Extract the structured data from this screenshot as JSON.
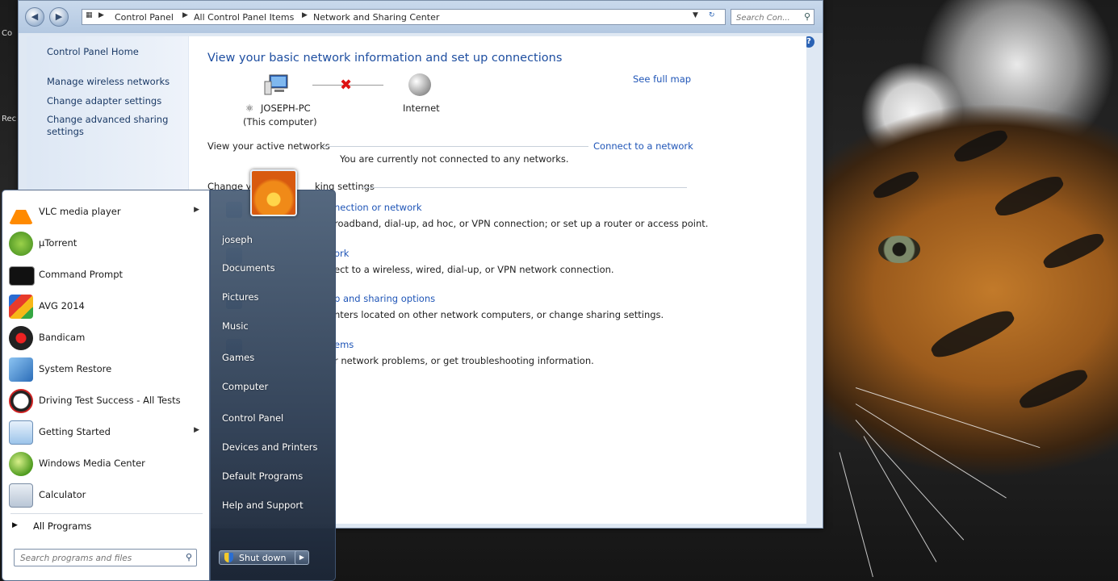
{
  "window": {
    "address": {
      "breadcrumbs": [
        "Control Panel",
        "All Control Panel Items",
        "Network and Sharing Center"
      ]
    },
    "search": {
      "placeholder": "Search Con..."
    }
  },
  "left_pane": {
    "links": [
      "Control Panel Home",
      "Manage wireless networks",
      "Change adapter settings",
      "Change advanced sharing",
      "settings"
    ]
  },
  "main": {
    "heading": "View your basic network information and set up connections",
    "see_full_map": "See full map",
    "computer_name": "JOSEPH-PC",
    "computer_sub": "(This computer)",
    "internet_label": "Internet",
    "active_networks_label": "View your active networks",
    "connect_link": "Connect to a network",
    "not_connected": "You are currently not connected to any networks.",
    "change_settings_head_a": "Change y",
    "change_settings_head_b": "king settings",
    "settings": [
      {
        "link": "nection or network",
        "desc": "roadband, dial-up, ad hoc, or VPN connection; or set up a router or access point."
      },
      {
        "link": "ork",
        "desc": "ect to a wireless, wired, dial-up, or VPN network connection."
      },
      {
        "link": "p and sharing options",
        "desc": "nters located on other network computers, or change sharing settings."
      },
      {
        "link": "ems",
        "desc": "r network problems, or get troubleshooting information."
      }
    ]
  },
  "start_menu": {
    "programs": [
      {
        "label": "VLC media player",
        "icon": "vlc-icon",
        "submenu": true
      },
      {
        "label": "µTorrent",
        "icon": "utorrent-icon",
        "submenu": false
      },
      {
        "label": "Command Prompt",
        "icon": "command-prompt-icon",
        "submenu": false
      },
      {
        "label": "AVG 2014",
        "icon": "avg-icon",
        "submenu": false
      },
      {
        "label": "Bandicam",
        "icon": "bandicam-icon",
        "submenu": false
      },
      {
        "label": "System Restore",
        "icon": "system-restore-icon",
        "submenu": false
      },
      {
        "label": "Driving Test Success - All Tests",
        "icon": "driving-test-icon",
        "submenu": false
      },
      {
        "label": "Getting Started",
        "icon": "getting-started-icon",
        "submenu": true
      },
      {
        "label": "Windows Media Center",
        "icon": "media-center-icon",
        "submenu": false
      },
      {
        "label": "Calculator",
        "icon": "calculator-icon",
        "submenu": false
      }
    ],
    "all_programs": "All Programs",
    "search_placeholder": "Search programs and files",
    "right_items": [
      "joseph",
      "Documents",
      "Pictures",
      "Music",
      "Games",
      "Computer",
      "Control Panel",
      "Devices and Printers",
      "Default Programs",
      "Help and Support"
    ],
    "shutdown_label": "Shut down"
  },
  "desktop": {
    "icon_labels": [
      "Co",
      "Rec"
    ]
  }
}
